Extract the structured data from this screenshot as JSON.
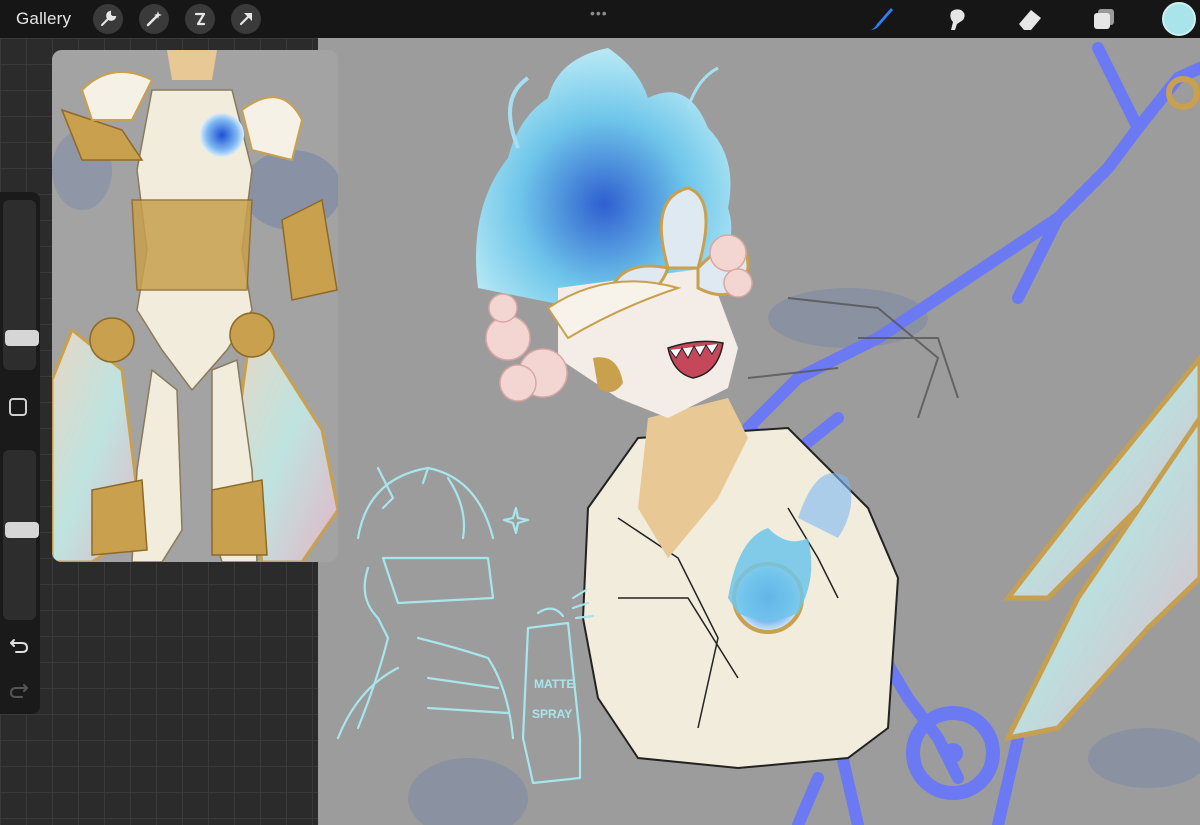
{
  "topbar": {
    "gallery_label": "Gallery",
    "left_tools": [
      {
        "name": "actions-wrench-icon"
      },
      {
        "name": "adjustments-magic-wand-icon"
      },
      {
        "name": "selection-icon"
      },
      {
        "name": "transform-arrow-icon"
      }
    ],
    "right_tools": [
      {
        "name": "brush-icon",
        "active": true
      },
      {
        "name": "smudge-icon",
        "active": false
      },
      {
        "name": "eraser-icon",
        "active": false
      },
      {
        "name": "layers-icon",
        "active": false
      }
    ],
    "current_color": "#a9e4ea"
  },
  "sidebar": {
    "brush_size_level": 0.35,
    "opacity_level": 0.45
  },
  "canvas": {
    "background_color": "#9c9c9c",
    "annotation_text": "",
    "sketch_text": [
      "MATTE",
      "SPRAY"
    ]
  },
  "reference": {
    "visible": true
  },
  "colors": {
    "accent_blue": "#2f7df6",
    "sketch_blue": "#6b79f3",
    "sketch_cyan": "#a7e6ec",
    "flame_blue": "#6fc6ea",
    "gold": "#c9a04d",
    "cream": "#f1ecdc"
  }
}
